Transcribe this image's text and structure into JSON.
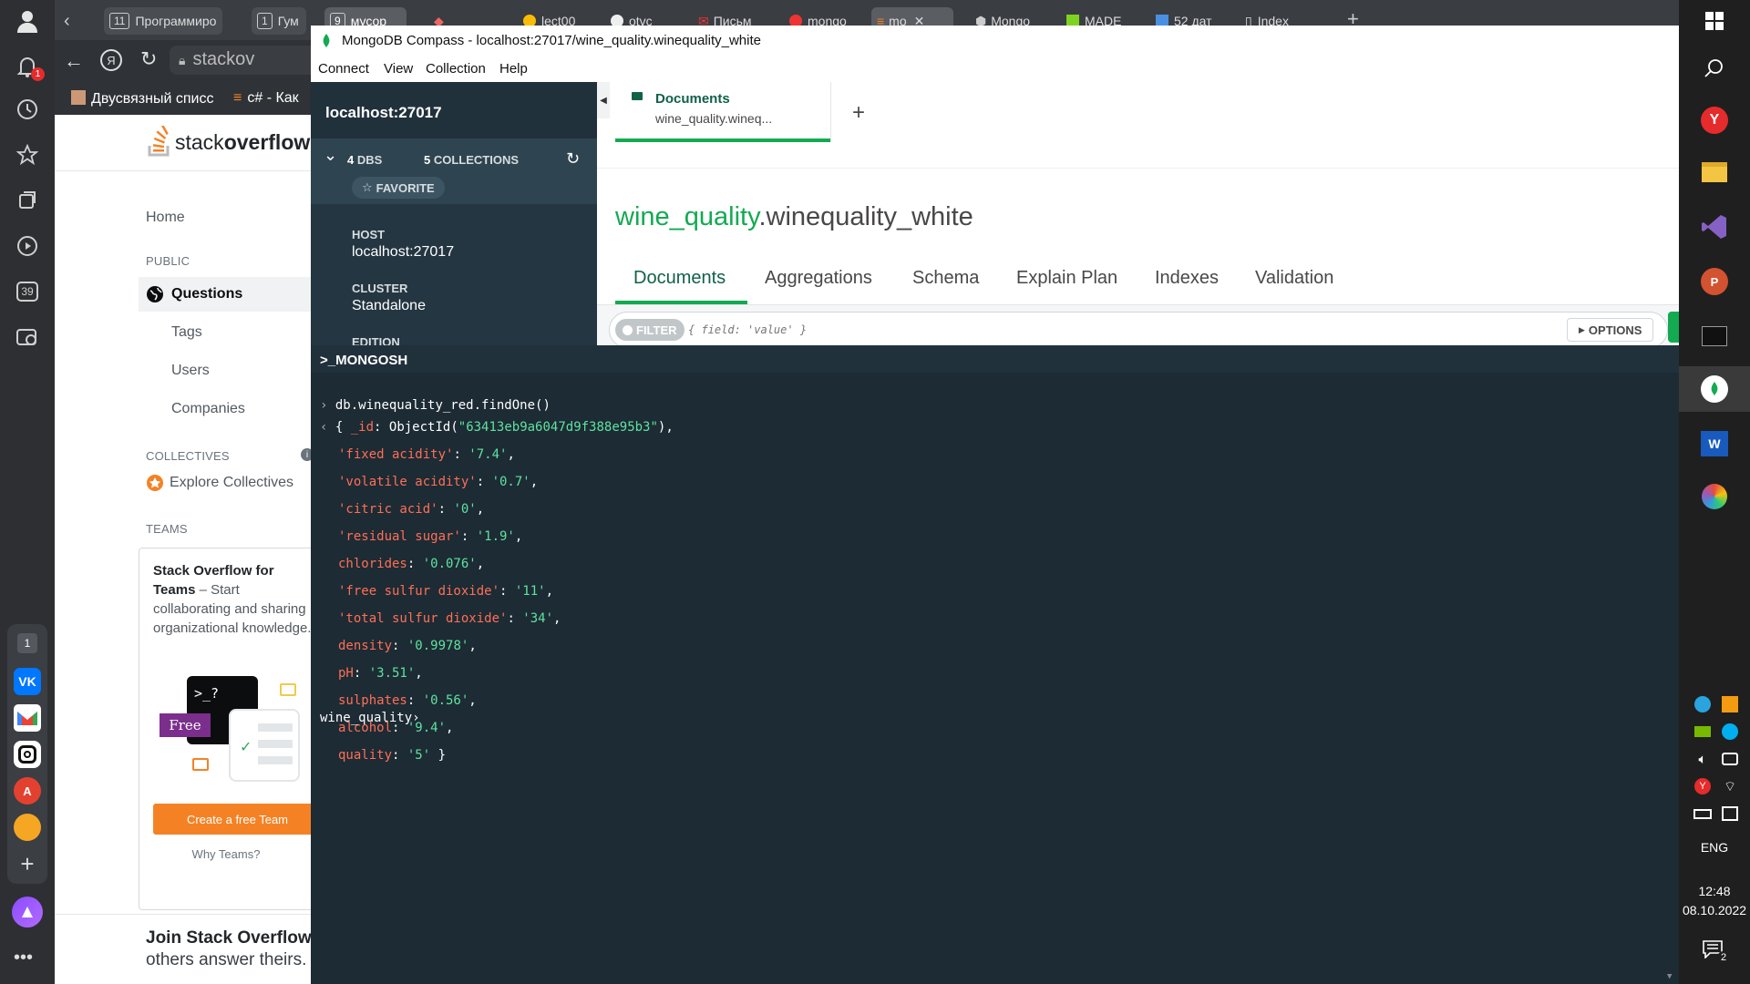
{
  "browser": {
    "tabs": [
      {
        "num": "11",
        "label": "Программиро"
      },
      {
        "num": "1",
        "label": "Гум"
      },
      {
        "num": "9",
        "label": "мусор"
      },
      {
        "label": "lect00"
      },
      {
        "label": "otvc"
      },
      {
        "label": "Письм"
      },
      {
        "label": "mongo"
      },
      {
        "label": "mo"
      },
      {
        "label": "Mongo"
      },
      {
        "label": "MADE"
      },
      {
        "label": "52 дат"
      },
      {
        "label": "Index"
      }
    ],
    "address": "stackov",
    "bookmarks": [
      "Двусвязный списс",
      "c# - Как"
    ],
    "notification_count": "1",
    "sidebar_badge": "39",
    "sidebar_tab_count": "1"
  },
  "stackoverflow": {
    "logo_text_1": "stack",
    "logo_text_2": "overflow",
    "nav": {
      "home": "Home",
      "public": "PUBLIC",
      "questions": "Questions",
      "tags": "Tags",
      "users": "Users",
      "companies": "Companies",
      "collectives": "COLLECTIVES",
      "explore": "Explore Collectives",
      "teams": "TEAMS"
    },
    "teams_card": {
      "title": "Stack Overflow for Teams",
      "desc": " – Start collaborating and sharing organizational knowledge.",
      "terminal": ">_?",
      "badge": "Free",
      "button": "Create a free Team",
      "why": "Why Teams?"
    },
    "join_title": "Join Stack Overflow",
    "join_sub": "others answer theirs."
  },
  "compass": {
    "window_title": "MongoDB Compass - localhost:27017/wine_quality.winequality_white",
    "menu": [
      "Connect",
      "View",
      "Collection",
      "Help"
    ],
    "sidebar": {
      "host_title": "localhost:27017",
      "dbs_count": "4",
      "dbs_label": "DBS",
      "collections_count": "5",
      "collections_label": "COLLECTIONS",
      "favorite": "FAVORITE",
      "host_label": "HOST",
      "host_value": "localhost:27017",
      "cluster_label": "CLUSTER",
      "cluster_value": "Standalone",
      "edition_label": "EDITION"
    },
    "workspace_tab": {
      "title": "Documents",
      "subtitle": "wine_quality.wineq..."
    },
    "namespace_db": "wine_quality",
    "namespace_coll": ".winequality_white",
    "subtabs": [
      "Documents",
      "Aggregations",
      "Schema",
      "Explain Plan",
      "Indexes",
      "Validation"
    ],
    "filter_label": "FILTER",
    "filter_placeholder": "{ field: 'value' }",
    "options_label": "OPTIONS",
    "mongosh_label": ">_MONGOSH",
    "shell": {
      "command": "db.winequality_red.findOne()",
      "prompt": "wine_quality",
      "id_key": "_id",
      "id_func": "ObjectId",
      "id_value": "\"63413eb9a6047d9f388e95b3\"",
      "fields": [
        {
          "key": "'fixed acidity'",
          "value": "'7.4'"
        },
        {
          "key": "'volatile acidity'",
          "value": "'0.7'"
        },
        {
          "key": "'citric acid'",
          "value": "'0'"
        },
        {
          "key": "'residual sugar'",
          "value": "'1.9'"
        },
        {
          "key": "chlorides",
          "value": "'0.076'"
        },
        {
          "key": "'free sulfur dioxide'",
          "value": "'11'"
        },
        {
          "key": "'total sulfur dioxide'",
          "value": "'34'"
        },
        {
          "key": "density",
          "value": "'0.9978'"
        },
        {
          "key": "pH",
          "value": "'3.51'"
        },
        {
          "key": "sulphates",
          "value": "'0.56'"
        },
        {
          "key": "alcohol",
          "value": "'9.4'"
        },
        {
          "key": "quality",
          "value": "'5'"
        }
      ]
    }
  },
  "taskbar": {
    "lang": "ENG",
    "time": "12:48",
    "date": "08.10.2022",
    "notif_count": "2"
  },
  "colors": {
    "mongo_green": "#13aa52",
    "shell_bg": "#1d2b34",
    "sidebar_bg": "#243642",
    "so_orange": "#f48225",
    "key_red": "#ff6f56",
    "string_green": "#5ee3a0"
  }
}
